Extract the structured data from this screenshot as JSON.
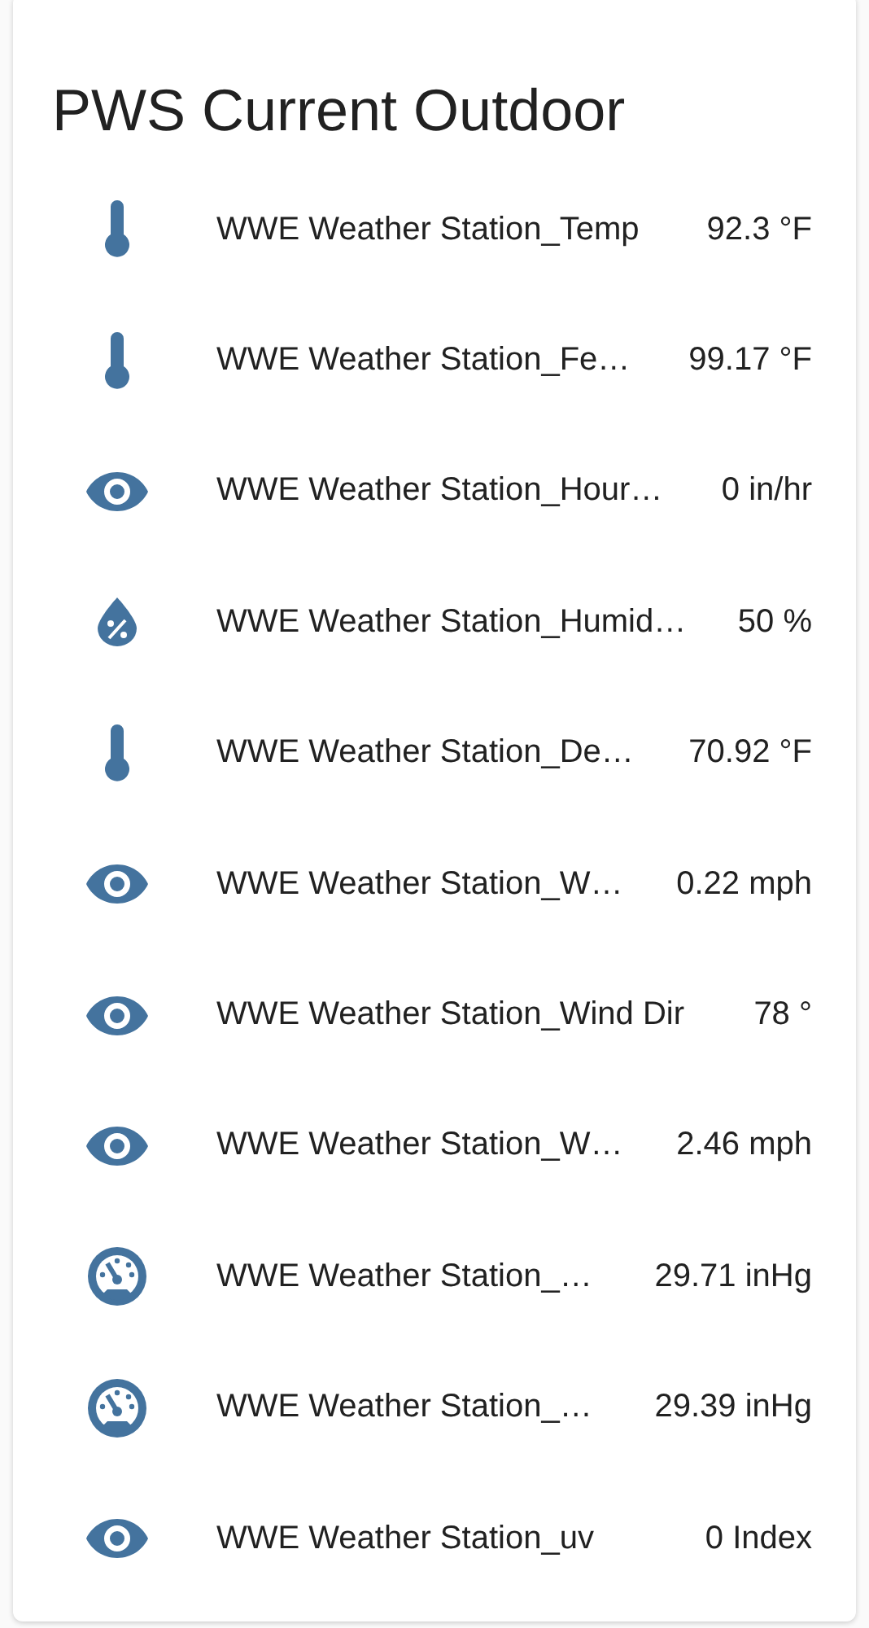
{
  "card": {
    "title": "PWS Current Outdoor",
    "entities": [
      {
        "kind": "thermometer",
        "name": "WWE Weather Station_Temp",
        "value": "92.3 °F"
      },
      {
        "kind": "thermometer",
        "name": "WWE Weather Station_Fe…",
        "value": "99.17 °F"
      },
      {
        "kind": "eye",
        "name": "WWE Weather Station_Hour…",
        "value": "0 in/hr"
      },
      {
        "kind": "humidity",
        "name": "WWE Weather Station_Humid…",
        "value": "50 %"
      },
      {
        "kind": "thermometer",
        "name": "WWE Weather Station_De…",
        "value": "70.92 °F"
      },
      {
        "kind": "eye",
        "name": "WWE Weather Station_W…",
        "value": "0.22 mph"
      },
      {
        "kind": "eye",
        "name": "WWE Weather Station_Wind Dir",
        "value": "78 °"
      },
      {
        "kind": "eye",
        "name": "WWE Weather Station_W…",
        "value": "2.46 mph"
      },
      {
        "kind": "gauge",
        "name": "WWE Weather Station_…",
        "value": "29.71 inHg"
      },
      {
        "kind": "gauge",
        "name": "WWE Weather Station_…",
        "value": "29.39 inHg"
      },
      {
        "kind": "eye",
        "name": "WWE Weather Station_uv",
        "value": "0 Index"
      }
    ]
  }
}
